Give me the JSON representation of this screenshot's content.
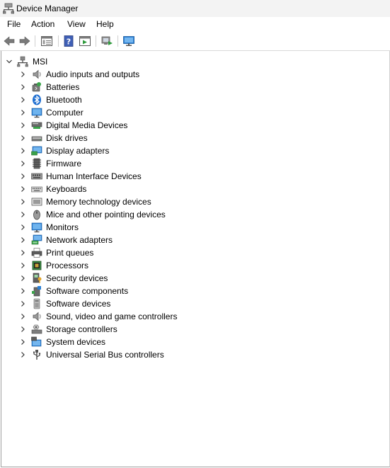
{
  "window": {
    "title": "Device Manager"
  },
  "menu": [
    {
      "label": "File"
    },
    {
      "label": "Action"
    },
    {
      "label": "View"
    },
    {
      "label": "Help"
    }
  ],
  "tree": {
    "root": {
      "label": "MSI",
      "icon": "computer-icon",
      "expanded": true
    },
    "items": [
      {
        "label": "Audio inputs and outputs",
        "icon": "speaker-icon"
      },
      {
        "label": "Batteries",
        "icon": "battery-icon"
      },
      {
        "label": "Bluetooth",
        "icon": "bluetooth-icon"
      },
      {
        "label": "Computer",
        "icon": "monitor-icon"
      },
      {
        "label": "Digital Media Devices",
        "icon": "media-device-icon"
      },
      {
        "label": "Disk drives",
        "icon": "disk-drive-icon"
      },
      {
        "label": "Display adapters",
        "icon": "display-adapter-icon"
      },
      {
        "label": "Firmware",
        "icon": "firmware-icon"
      },
      {
        "label": "Human Interface Devices",
        "icon": "hid-icon"
      },
      {
        "label": "Keyboards",
        "icon": "keyboard-icon"
      },
      {
        "label": "Memory technology devices",
        "icon": "memory-icon"
      },
      {
        "label": "Mice and other pointing devices",
        "icon": "mouse-icon"
      },
      {
        "label": "Monitors",
        "icon": "monitor-icon"
      },
      {
        "label": "Network adapters",
        "icon": "network-adapter-icon"
      },
      {
        "label": "Print queues",
        "icon": "printer-icon"
      },
      {
        "label": "Processors",
        "icon": "processor-icon"
      },
      {
        "label": "Security devices",
        "icon": "security-device-icon"
      },
      {
        "label": "Software components",
        "icon": "software-component-icon"
      },
      {
        "label": "Software devices",
        "icon": "software-device-icon"
      },
      {
        "label": "Sound, video and game controllers",
        "icon": "speaker-icon"
      },
      {
        "label": "Storage controllers",
        "icon": "storage-controller-icon"
      },
      {
        "label": "System devices",
        "icon": "system-device-icon"
      },
      {
        "label": "Universal Serial Bus controllers",
        "icon": "usb-icon"
      }
    ]
  }
}
